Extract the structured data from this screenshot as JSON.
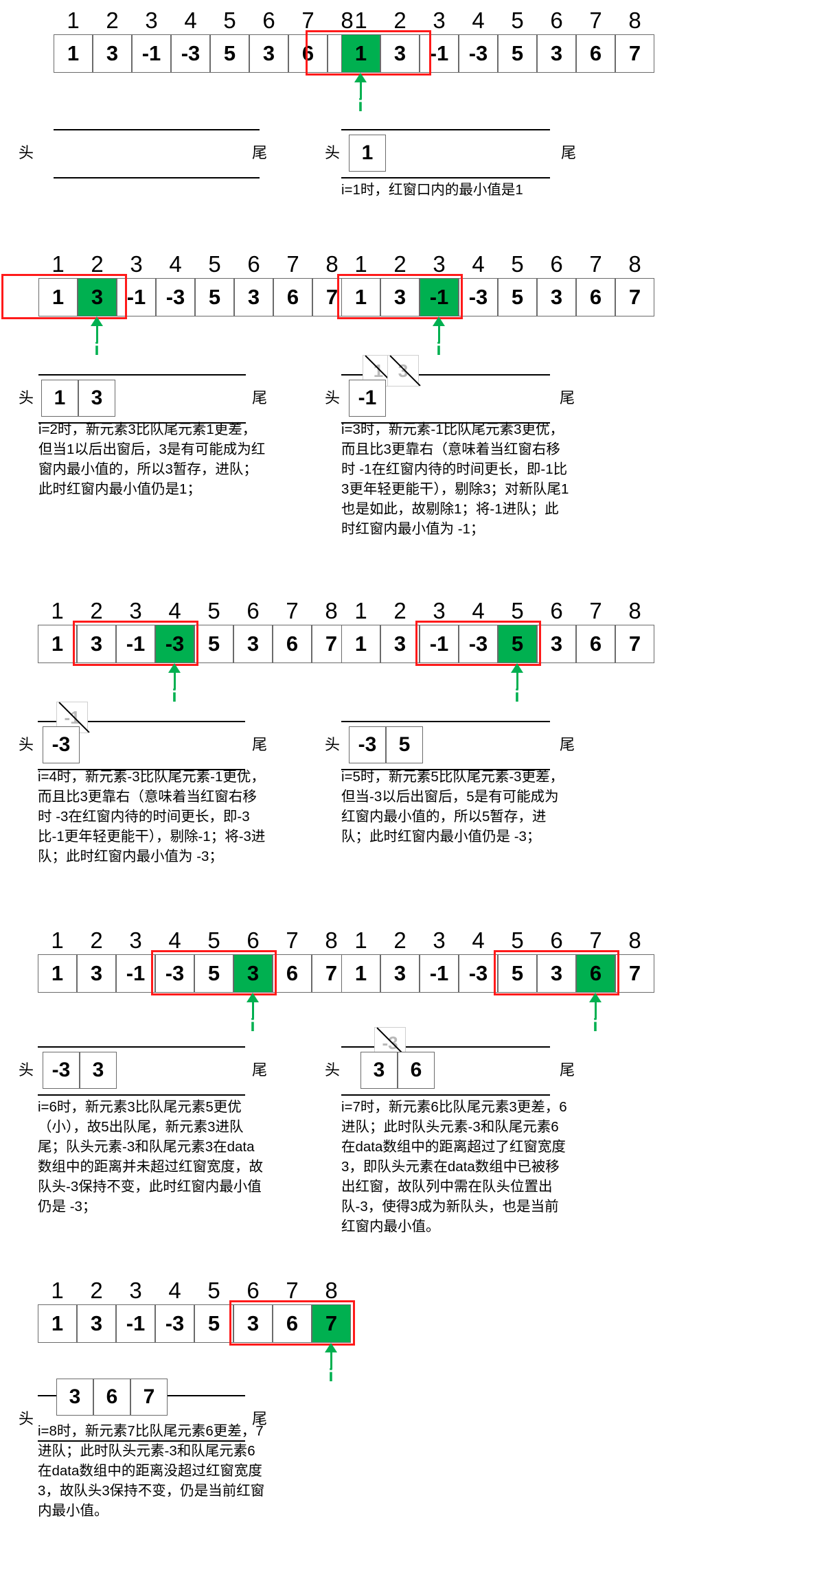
{
  "queue_labels": {
    "head": "头",
    "tail": "尾"
  },
  "pointer_label": "i",
  "colors": {
    "window": "#ff1a1a",
    "highlight": "#00b050",
    "pointer": "#00b050"
  },
  "indices": [
    "1",
    "2",
    "3",
    "4",
    "5",
    "6",
    "7",
    "8"
  ],
  "data": [
    "1",
    "3",
    "-1",
    "-3",
    "5",
    "3",
    "6",
    "7"
  ],
  "panels": [
    {
      "current": null,
      "window": null,
      "queue": [],
      "removed": [],
      "text": ""
    },
    {
      "current": 1,
      "window": [
        1,
        1
      ],
      "queue": [
        "1"
      ],
      "removed": [],
      "text": "i=1时，红窗口内的最小值是1"
    },
    {
      "current": 2,
      "window": [
        1,
        2
      ],
      "queue": [
        "1",
        "3"
      ],
      "removed": [],
      "text": "i=2时，新元素3比队尾元素1更差，但当1以后出窗后，3是有可能成为红窗内最小值的，所以3暂存，进队；此时红窗内最小值仍是1；"
    },
    {
      "current": 3,
      "window": [
        1,
        3
      ],
      "queue": [
        "-1"
      ],
      "removed": [
        "1",
        "3"
      ],
      "text": "i=3时，新元素-1比队尾元素3更优，而且比3更靠右（意味着当红窗右移时 -1在红窗内待的时间更长，即-1比3更年轻更能干），剔除3；对新队尾1也是如此，故剔除1；将-1进队；此时红窗内最小值为 -1；"
    },
    {
      "current": 4,
      "window": [
        2,
        4
      ],
      "queue": [
        "-3"
      ],
      "removed": [
        "-1"
      ],
      "text": "i=4时，新元素-3比队尾元素-1更优，而且比3更靠右（意味着当红窗右移时 -3在红窗内待的时间更长，即-3比-1更年轻更能干），剔除-1；将-3进队；此时红窗内最小值为 -3；"
    },
    {
      "current": 5,
      "window": [
        3,
        5
      ],
      "queue": [
        "-3",
        "5"
      ],
      "removed": [],
      "text": "i=5时，新元素5比队尾元素-3更差，但当-3以后出窗后，5是有可能成为红窗内最小值的，所以5暂存，进队；此时红窗内最小值仍是 -3；"
    },
    {
      "current": 6,
      "window": [
        4,
        6
      ],
      "queue": [
        "-3",
        "3"
      ],
      "removed": [],
      "text": "i=6时，新元素3比队尾元素5更优（小），故5出队尾，新元素3进队尾；队头元素-3和队尾元素3在data数组中的距离并未超过红窗宽度，故队头-3保持不变，此时红窗内最小值仍是 -3；"
    },
    {
      "current": 7,
      "window": [
        5,
        7
      ],
      "queue": [
        "3",
        "6"
      ],
      "removed": [
        "-3"
      ],
      "text": "i=7时，新元素6比队尾元素3更差，6进队；此时队头元素-3和队尾元素6在data数组中的距离超过了红窗宽度3，即队头元素在data数组中已被移出红窗，故队列中需在队头位置出队-3，使得3成为新队头，也是当前红窗内最小值。"
    },
    {
      "current": 8,
      "window": [
        6,
        8
      ],
      "queue": [
        "3",
        "6",
        "7"
      ],
      "removed": [],
      "text": "i=8时，新元素7比队尾元素6更差，7进队；此时队头元素-3和队尾元素6在data数组中的距离没超过红窗宽度3，故队头3保持不变，仍是当前红窗内最小值。"
    }
  ]
}
